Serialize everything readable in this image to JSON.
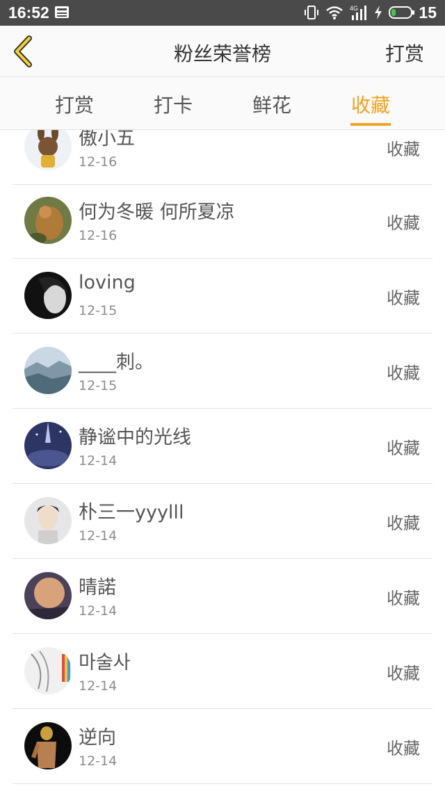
{
  "status_bar": {
    "time": "16:52",
    "battery": "15",
    "network": "4G"
  },
  "header": {
    "title": "粉丝荣誉榜",
    "right_action": "打赏"
  },
  "tabs": [
    "打赏",
    "打卡",
    "鲜花",
    "收藏"
  ],
  "active_tab": "收藏",
  "accent_color": "#f0a31e",
  "list": [
    {
      "name": "傲小五",
      "date": "12-16",
      "action": "收藏"
    },
    {
      "name": "何为冬暖 何所夏凉",
      "date": "12-16",
      "action": "收藏"
    },
    {
      "name": "loving",
      "date": "12-15",
      "action": "收藏"
    },
    {
      "name": "____刺。",
      "date": "12-15",
      "action": "收藏"
    },
    {
      "name": "静谧中的光线",
      "date": "12-14",
      "action": "收藏"
    },
    {
      "name": "朴三一yyylll",
      "date": "12-14",
      "action": "收藏"
    },
    {
      "name": "晴諾",
      "date": "12-14",
      "action": "收藏"
    },
    {
      "name": "마술사",
      "date": "12-14",
      "action": "收藏"
    },
    {
      "name": "逆向",
      "date": "12-14",
      "action": "收藏"
    }
  ]
}
